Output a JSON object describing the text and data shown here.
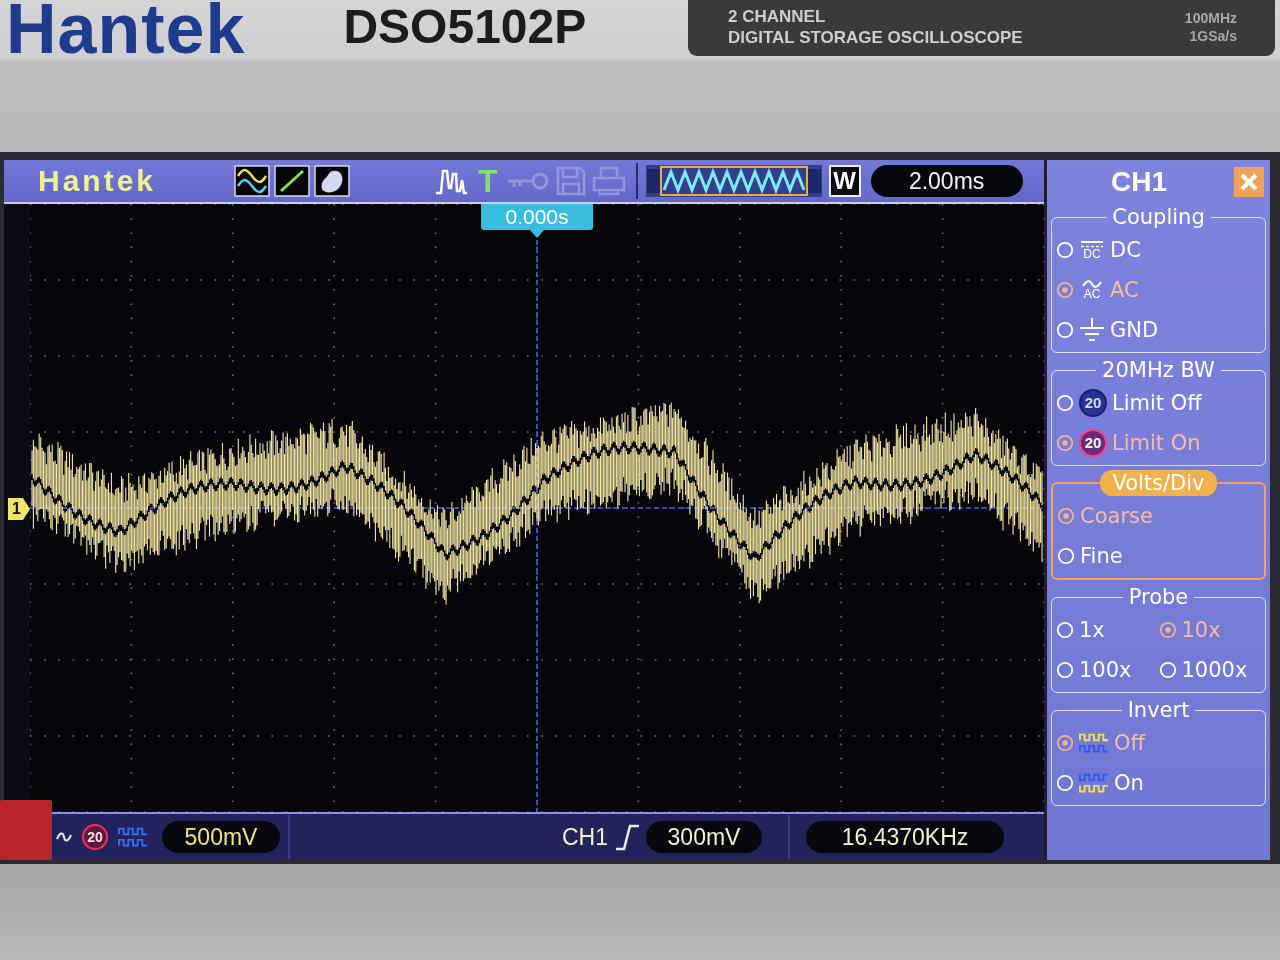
{
  "bezel": {
    "brand": "Hantek",
    "model": "DSO5102P",
    "plate": {
      "lines": [
        "2 CHANNEL",
        "DIGITAL STORAGE OSCILLOSCOPE"
      ],
      "specs": [
        "100MHz",
        "1GSa/s"
      ]
    }
  },
  "toolbar": {
    "logo": "Hantek",
    "tools": [
      {
        "kind": "pulse",
        "disabled": false
      },
      {
        "kind": "trigger",
        "symbol": "T",
        "disabled": false
      },
      {
        "kind": "key",
        "disabled": true
      },
      {
        "kind": "save",
        "disabled": true
      },
      {
        "kind": "print",
        "disabled": true
      }
    ],
    "zoom_key": "W",
    "timebase": "2.00ms"
  },
  "plot": {
    "trigger_position": "0.000s",
    "channel_marker": "1"
  },
  "status_bar": {
    "bandwidth_badge": "20",
    "volts_per_div": "500mV",
    "trigger_source": "CH1",
    "trigger_level": "300mV",
    "frequency": "16.4370KHz"
  },
  "channel_menu": {
    "title": "CH1",
    "sections": [
      {
        "title": "Coupling",
        "kind": "list",
        "focused": false,
        "options": [
          {
            "label": "DC",
            "kind": "dc",
            "icon_text": "DC",
            "selected": false
          },
          {
            "label": "AC",
            "kind": "ac",
            "icon_text": "AC",
            "selected": true
          },
          {
            "label": "GND",
            "kind": "gnd",
            "selected": false
          }
        ]
      },
      {
        "title": "20MHz BW",
        "kind": "list",
        "focused": false,
        "options": [
          {
            "label": "Limit Off",
            "kind": "bw-off",
            "icon_text": "20",
            "selected": false
          },
          {
            "label": "Limit On",
            "kind": "bw-on",
            "icon_text": "20",
            "selected": true
          }
        ]
      },
      {
        "title": "Volts/Div",
        "kind": "list",
        "focused": true,
        "options": [
          {
            "label": "Coarse",
            "kind": "plain",
            "selected": true
          },
          {
            "label": "Fine",
            "kind": "plain",
            "selected": false
          }
        ]
      },
      {
        "title": "Probe",
        "kind": "grid",
        "focused": false,
        "options": [
          {
            "label": "1x",
            "kind": "plain",
            "selected": false
          },
          {
            "label": "10x",
            "kind": "plain",
            "selected": true
          },
          {
            "label": "100x",
            "kind": "plain",
            "selected": false
          },
          {
            "label": "1000x",
            "kind": "plain",
            "selected": false
          }
        ]
      },
      {
        "title": "Invert",
        "kind": "list",
        "focused": false,
        "options": [
          {
            "label": "Off",
            "kind": "wave-normal",
            "selected": true
          },
          {
            "label": "On",
            "kind": "wave-inverted",
            "selected": false
          }
        ]
      }
    ]
  }
}
